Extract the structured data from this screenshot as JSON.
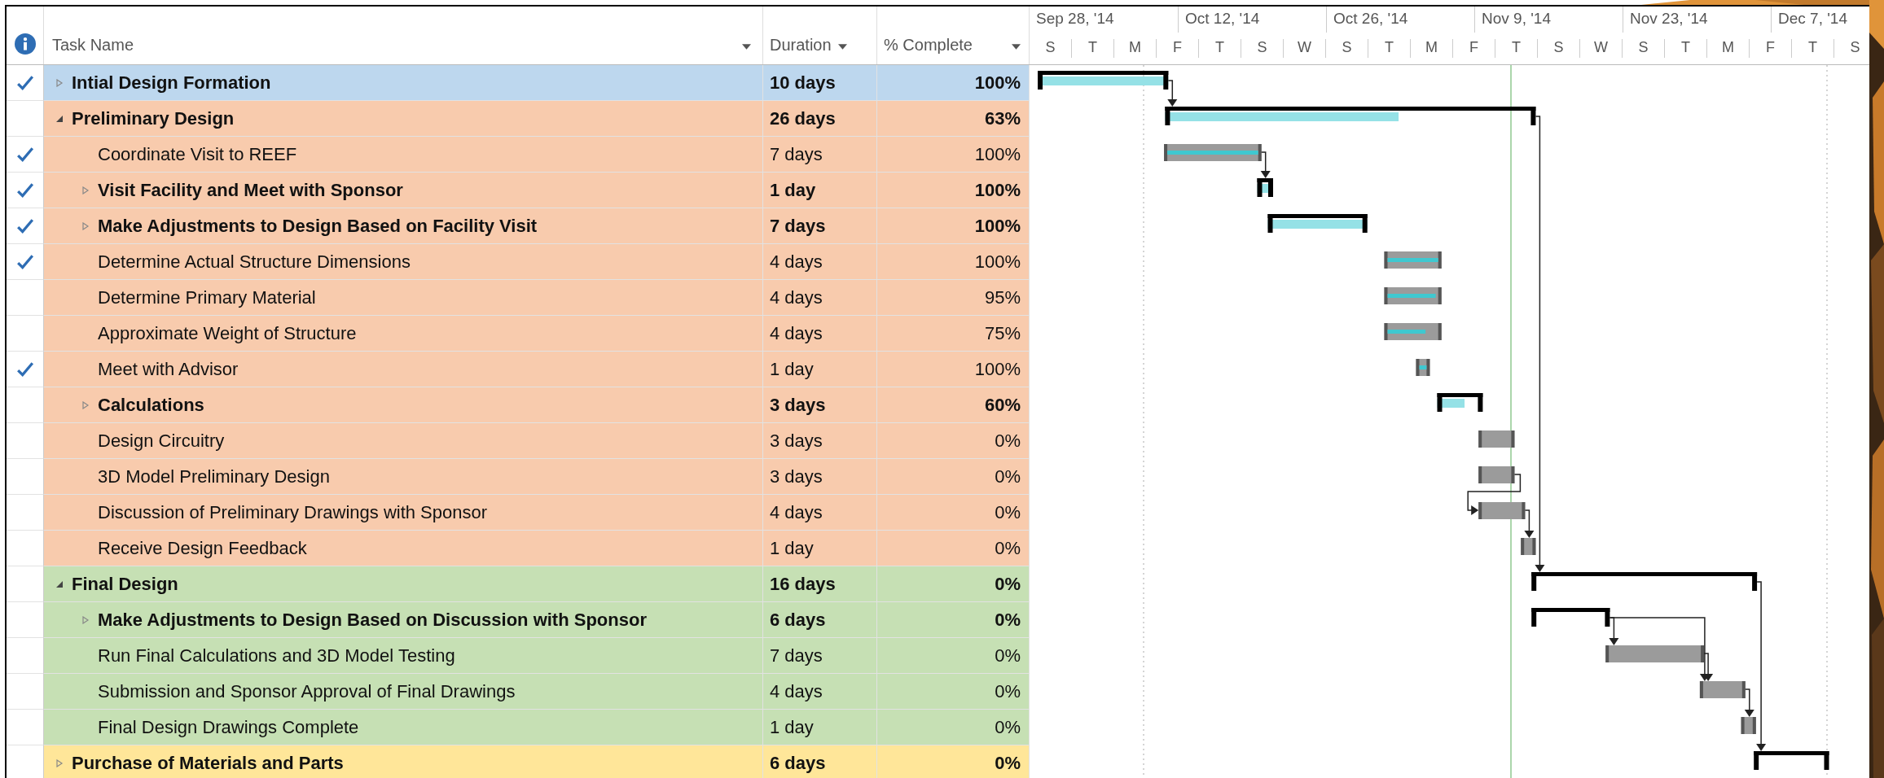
{
  "columns": [
    {
      "label": "Task Name"
    },
    {
      "label": "Duration"
    },
    {
      "label": "% Complete"
    }
  ],
  "timescale": {
    "major": [
      "Sep 28, '14",
      "Oct 12, '14",
      "Oct 26, '14",
      "Nov 9, '14",
      "Nov 23, '14",
      "Dec 7, '14"
    ],
    "minor": [
      "S",
      "T",
      "M",
      "F",
      "T",
      "S",
      "W",
      "S",
      "T",
      "M",
      "F",
      "T",
      "S",
      "W",
      "S",
      "T",
      "M",
      "F",
      "T",
      "S"
    ]
  },
  "tasks": [
    {
      "kind": "summary",
      "name": "Intial Design Formation",
      "duration": "10 days",
      "complete": "100%",
      "checked": true,
      "expanded": false,
      "color": "#bdd7ee"
    },
    {
      "kind": "summary",
      "name": "Preliminary Design",
      "duration": "26 days",
      "complete": "63%",
      "checked": false,
      "expanded": true,
      "color": "#f8cbad",
      "children": [
        {
          "kind": "task",
          "name": "Coordinate Visit to REEF",
          "duration": "7 days",
          "complete": "100%",
          "checked": true
        },
        {
          "kind": "summary",
          "name": "Visit Facility and Meet with Sponsor",
          "duration": "1 day",
          "complete": "100%",
          "checked": true,
          "expanded": false
        },
        {
          "kind": "summary",
          "name": "Make Adjustments to Design Based on Facility Visit",
          "duration": "7 days",
          "complete": "100%",
          "checked": true,
          "expanded": false
        },
        {
          "kind": "task",
          "name": "Determine Actual Structure Dimensions",
          "duration": "4 days",
          "complete": "100%",
          "checked": true
        },
        {
          "kind": "task",
          "name": "Determine Primary Material",
          "duration": "4 days",
          "complete": "95%",
          "checked": false
        },
        {
          "kind": "task",
          "name": "Approximate Weight of Structure",
          "duration": "4 days",
          "complete": "75%",
          "checked": false
        },
        {
          "kind": "task",
          "name": "Meet with Advisor",
          "duration": "1 day",
          "complete": "100%",
          "checked": true
        },
        {
          "kind": "summary",
          "name": "Calculations",
          "duration": "3 days",
          "complete": "60%",
          "checked": false,
          "expanded": false
        },
        {
          "kind": "task",
          "name": "Design Circuitry",
          "duration": "3 days",
          "complete": "0%",
          "checked": false
        },
        {
          "kind": "task",
          "name": "3D Model Preliminary Design",
          "duration": "3 days",
          "complete": "0%",
          "checked": false
        },
        {
          "kind": "task",
          "name": "Discussion of Preliminary Drawings with Sponsor",
          "duration": "4 days",
          "complete": "0%",
          "checked": false
        },
        {
          "kind": "task",
          "name": "Receive Design Feedback",
          "duration": "1 day",
          "complete": "0%",
          "checked": false
        }
      ]
    },
    {
      "kind": "summary",
      "name": "Final Design",
      "duration": "16 days",
      "complete": "0%",
      "checked": false,
      "expanded": true,
      "color": "#c6e0b4",
      "children": [
        {
          "kind": "summary",
          "name": "Make Adjustments to Design Based on Discussion with Sponsor",
          "duration": "6 days",
          "complete": "0%",
          "checked": false,
          "expanded": false
        },
        {
          "kind": "task",
          "name": "Run Final Calculations and 3D Model Testing",
          "duration": "7 days",
          "complete": "0%",
          "checked": false
        },
        {
          "kind": "task",
          "name": "Submission and Sponsor Approval of Final Drawings",
          "duration": "4 days",
          "complete": "0%",
          "checked": false
        },
        {
          "kind": "task",
          "name": "Final Design Drawings Complete",
          "duration": "1 day",
          "complete": "0%",
          "checked": false
        }
      ]
    },
    {
      "kind": "summary",
      "name": "Purchase of Materials and Parts",
      "duration": "6 days",
      "complete": "0%",
      "checked": false,
      "expanded": false,
      "color": "#ffe699"
    }
  ]
}
